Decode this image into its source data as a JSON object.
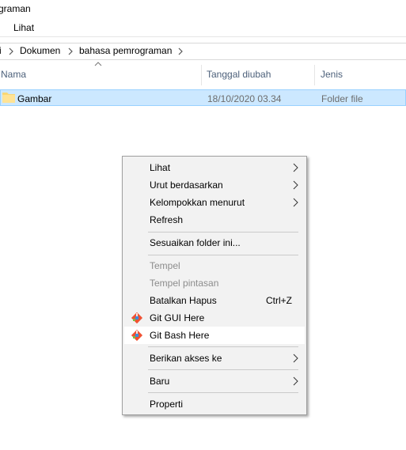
{
  "window": {
    "title_fragment": "grogram an",
    "title_display": "graman"
  },
  "ribbon": {
    "tab_view": "Lihat"
  },
  "address_bar": {
    "leading_fragment": "i",
    "crumbs": [
      "Dokumen",
      "bahasa pemrograman"
    ]
  },
  "file_list": {
    "columns": {
      "name": "Nama",
      "date": "Tanggal diubah",
      "type": "Jenis"
    },
    "rows": [
      {
        "name": "Gambar",
        "date": "18/10/2020 03.34",
        "type": "Folder file"
      }
    ]
  },
  "context_menu": {
    "items": [
      {
        "label": "Lihat",
        "submenu": true
      },
      {
        "label": "Urut berdasarkan",
        "submenu": true
      },
      {
        "label": "Kelompokkan menurut",
        "submenu": true
      },
      {
        "label": "Refresh"
      },
      {
        "label": "Sesuaikan folder ini..."
      },
      {
        "label": "Tempel",
        "disabled": true
      },
      {
        "label": "Tempel pintasan",
        "disabled": true
      },
      {
        "label": "Batalkan Hapus",
        "shortcut": "Ctrl+Z"
      },
      {
        "label": "Git GUI Here",
        "icon": "git-icon"
      },
      {
        "label": "Git Bash Here",
        "icon": "git-icon",
        "highlighted": true
      },
      {
        "label": "Berikan akses ke",
        "submenu": true
      },
      {
        "label": "Baru",
        "submenu": true
      },
      {
        "label": "Properti"
      }
    ]
  },
  "colors": {
    "selection": "#cce8ff",
    "selection_border": "#99d1ff",
    "menu_bg": "#f2f2f2",
    "header_text": "#4c607a"
  }
}
